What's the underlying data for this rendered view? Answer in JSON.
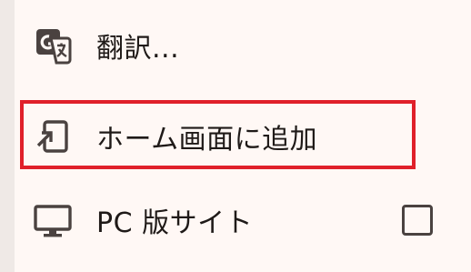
{
  "menu": {
    "items": [
      {
        "label": "翻訳...",
        "icon": "translate-icon"
      },
      {
        "label": "ホーム画面に追加",
        "icon": "add-to-home-screen-icon"
      },
      {
        "label": "PC 版サイト",
        "icon": "desktop-icon",
        "checkbox": "unchecked"
      }
    ]
  },
  "colors": {
    "background": "#fff8f5",
    "text": "#1f1a18",
    "icon": "#4a4240",
    "highlight": "#e0202a"
  }
}
